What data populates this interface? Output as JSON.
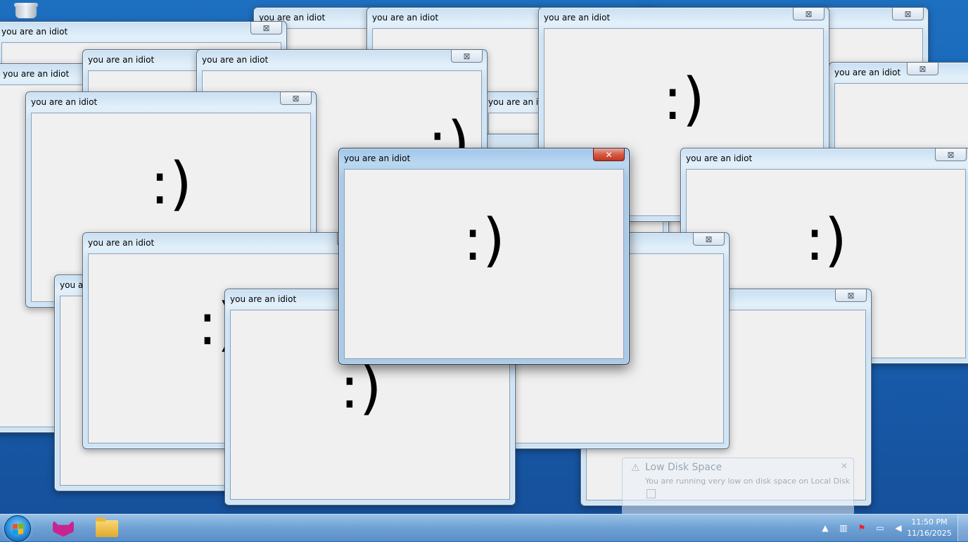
{
  "app": {
    "window_title": "you are an idiot",
    "face_text": ":)",
    "close_glyph": "⊠",
    "active_close_glyph": "✕"
  },
  "windows": [
    {
      "id": 1
    },
    {
      "id": 2
    },
    {
      "id": 3
    },
    {
      "id": 4
    },
    {
      "id": 5
    },
    {
      "id": 6
    },
    {
      "id": 7
    },
    {
      "id": 8
    },
    {
      "id": 9
    },
    {
      "id": 10
    },
    {
      "id": 11
    },
    {
      "id": 12
    },
    {
      "id": 13
    },
    {
      "id": 14
    },
    {
      "id": 15
    },
    {
      "id": 16
    },
    {
      "id": 17
    }
  ],
  "balloon": {
    "title": "Low Disk Space",
    "text": "You are running very low on disk space on Local Disk"
  },
  "taskbar": {
    "start_icon": "windows-start-orb",
    "pinned": [
      "fox-app-icon",
      "folder-icon"
    ],
    "tray_icons": [
      "show-hidden-icons-icon",
      "network-icon",
      "action-center-flag-icon",
      "display-icon",
      "volume-muted-icon"
    ],
    "clock": {
      "time": "11:50 PM",
      "date": "11/16/2025"
    }
  },
  "colors": {
    "accent": "#1a62b3",
    "active_close": "#c2361f",
    "client_bg": "#f0f0f0"
  }
}
